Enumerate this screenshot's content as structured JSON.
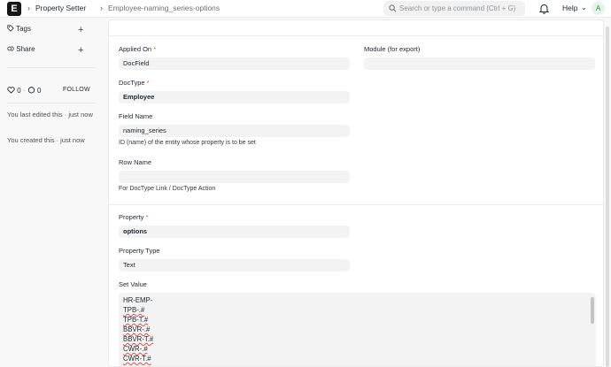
{
  "navbar": {
    "logo": "E",
    "breadcrumb_parent": "Property Setter",
    "breadcrumb_current": "Employee-naming_series-options",
    "search_placeholder": "Search or type a command (Ctrl + G)",
    "help_label": "Help",
    "avatar_initial": "A"
  },
  "sidebar": {
    "tags_label": "Tags",
    "share_label": "Share",
    "likes_count": "0",
    "comments_count": "0",
    "follow_label": "FOLLOW",
    "last_edited": "You last edited this · just now",
    "created": "You created this · just now"
  },
  "form": {
    "applied_on": {
      "label": "Applied On",
      "value": "DocField"
    },
    "module": {
      "label": "Module (for export)",
      "value": ""
    },
    "doctype": {
      "label": "DocType",
      "value": "Employee"
    },
    "field_name": {
      "label": "Field Name",
      "value": "naming_series",
      "description": "ID (name) of the entity whose property is to be set"
    },
    "row_name": {
      "label": "Row Name",
      "value": "",
      "description": "For DocType Link / DocType Action"
    },
    "property": {
      "label": "Property",
      "value": "options"
    },
    "property_type": {
      "label": "Property Type",
      "value": "Text"
    },
    "set_value": {
      "label": "Set Value",
      "lines": [
        "HR-EMP-",
        "TPB-.#",
        "TPB-T.#",
        "BBVR-.#",
        "BBVR-T.#",
        "CWR-.#",
        "CWR-T.#"
      ]
    }
  },
  "colors": {
    "required": "#e24c4c",
    "accent": "#171717"
  }
}
